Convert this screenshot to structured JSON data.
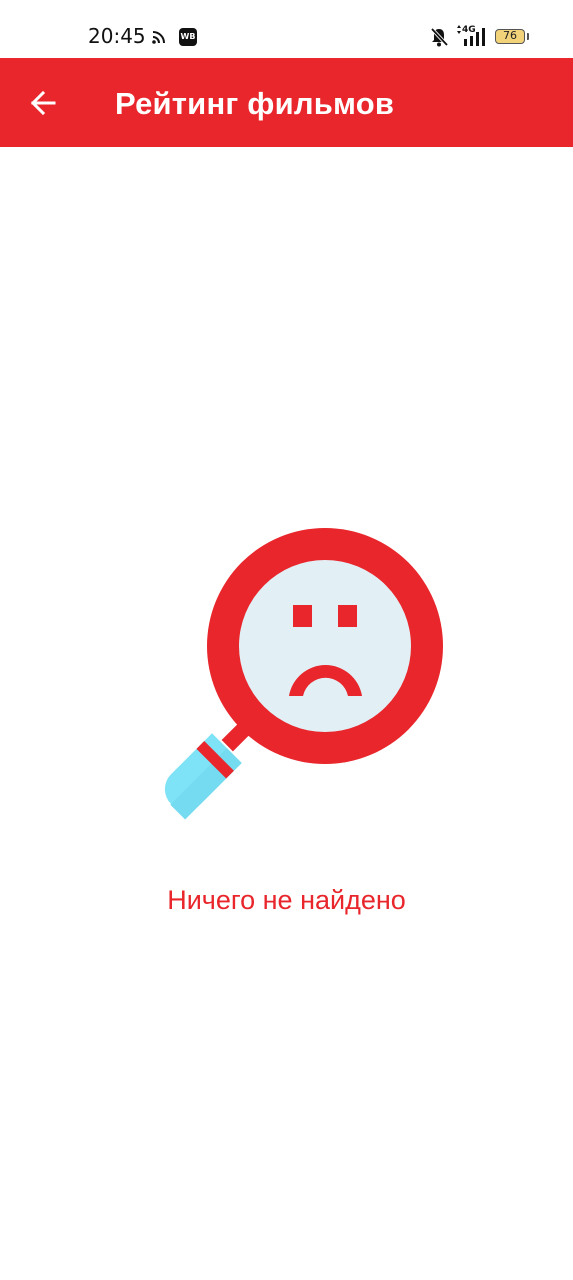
{
  "status_bar": {
    "time": "20:45",
    "app_badge": "WB",
    "network_type": "4G",
    "battery_level": "76",
    "icons": [
      "cast-icon",
      "wb-app-icon",
      "mute-icon",
      "signal-icon",
      "battery-icon"
    ]
  },
  "app_bar": {
    "back_icon": "arrow-left-icon",
    "title": "Рейтинг фильмов",
    "color": "#e8262b"
  },
  "empty_state": {
    "illustration": "sad-magnifier-icon",
    "message": "Ничего не найдено",
    "colors": {
      "accent": "#e8262b",
      "lens": "#e2f0f6",
      "handle": "#7fe3f7"
    }
  }
}
